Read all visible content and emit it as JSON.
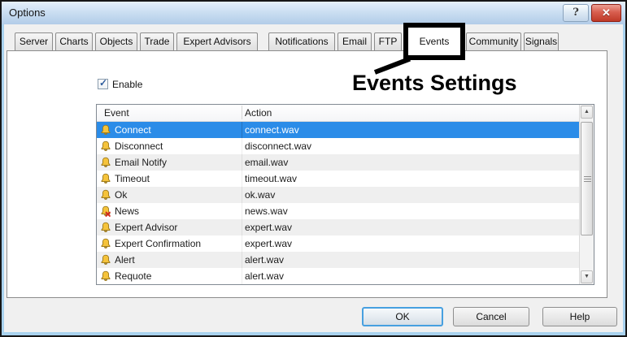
{
  "titlebar": {
    "title": "Options",
    "help_icon": "?",
    "close_icon": "✕"
  },
  "tabs": [
    {
      "label": "Server"
    },
    {
      "label": "Charts"
    },
    {
      "label": "Objects"
    },
    {
      "label": "Trade"
    },
    {
      "label": "Expert Advisors"
    },
    {
      "label": "Notifications"
    },
    {
      "label": "Email"
    },
    {
      "label": "FTP"
    },
    {
      "label": "Events",
      "selected": true
    },
    {
      "label": "Community"
    },
    {
      "label": "Signals"
    }
  ],
  "annotation": {
    "label": "Events Settings"
  },
  "enable": {
    "label": "Enable",
    "checked": true,
    "check_icon": "✓"
  },
  "table": {
    "columns": [
      "Event",
      "Action"
    ],
    "rows": [
      {
        "event": "Connect",
        "action": "connect.wav",
        "selected": true,
        "muted": false
      },
      {
        "event": "Disconnect",
        "action": "disconnect.wav",
        "selected": false,
        "muted": false
      },
      {
        "event": "Email Notify",
        "action": "email.wav",
        "selected": false,
        "muted": false
      },
      {
        "event": "Timeout",
        "action": "timeout.wav",
        "selected": false,
        "muted": false
      },
      {
        "event": "Ok",
        "action": "ok.wav",
        "selected": false,
        "muted": false
      },
      {
        "event": "News",
        "action": "news.wav",
        "selected": false,
        "muted": true
      },
      {
        "event": "Expert Advisor",
        "action": "expert.wav",
        "selected": false,
        "muted": false
      },
      {
        "event": "Expert Confirmation",
        "action": "expert.wav",
        "selected": false,
        "muted": false
      },
      {
        "event": "Alert",
        "action": "alert.wav",
        "selected": false,
        "muted": false
      },
      {
        "event": "Requote",
        "action": "alert.wav",
        "selected": false,
        "muted": false
      }
    ]
  },
  "scrollbar": {
    "up_icon": "▲",
    "down_icon": "▼"
  },
  "buttons": {
    "ok_label": "OK",
    "cancel_label": "Cancel",
    "help_label": "Help"
  },
  "colors": {
    "titlebar": "#c6dcf1",
    "selected_row": "#2b8ce8",
    "close_button": "#bf3a28",
    "annotation": "#000000",
    "bell": "#f5c33b",
    "frame": "#a9d2ee"
  }
}
